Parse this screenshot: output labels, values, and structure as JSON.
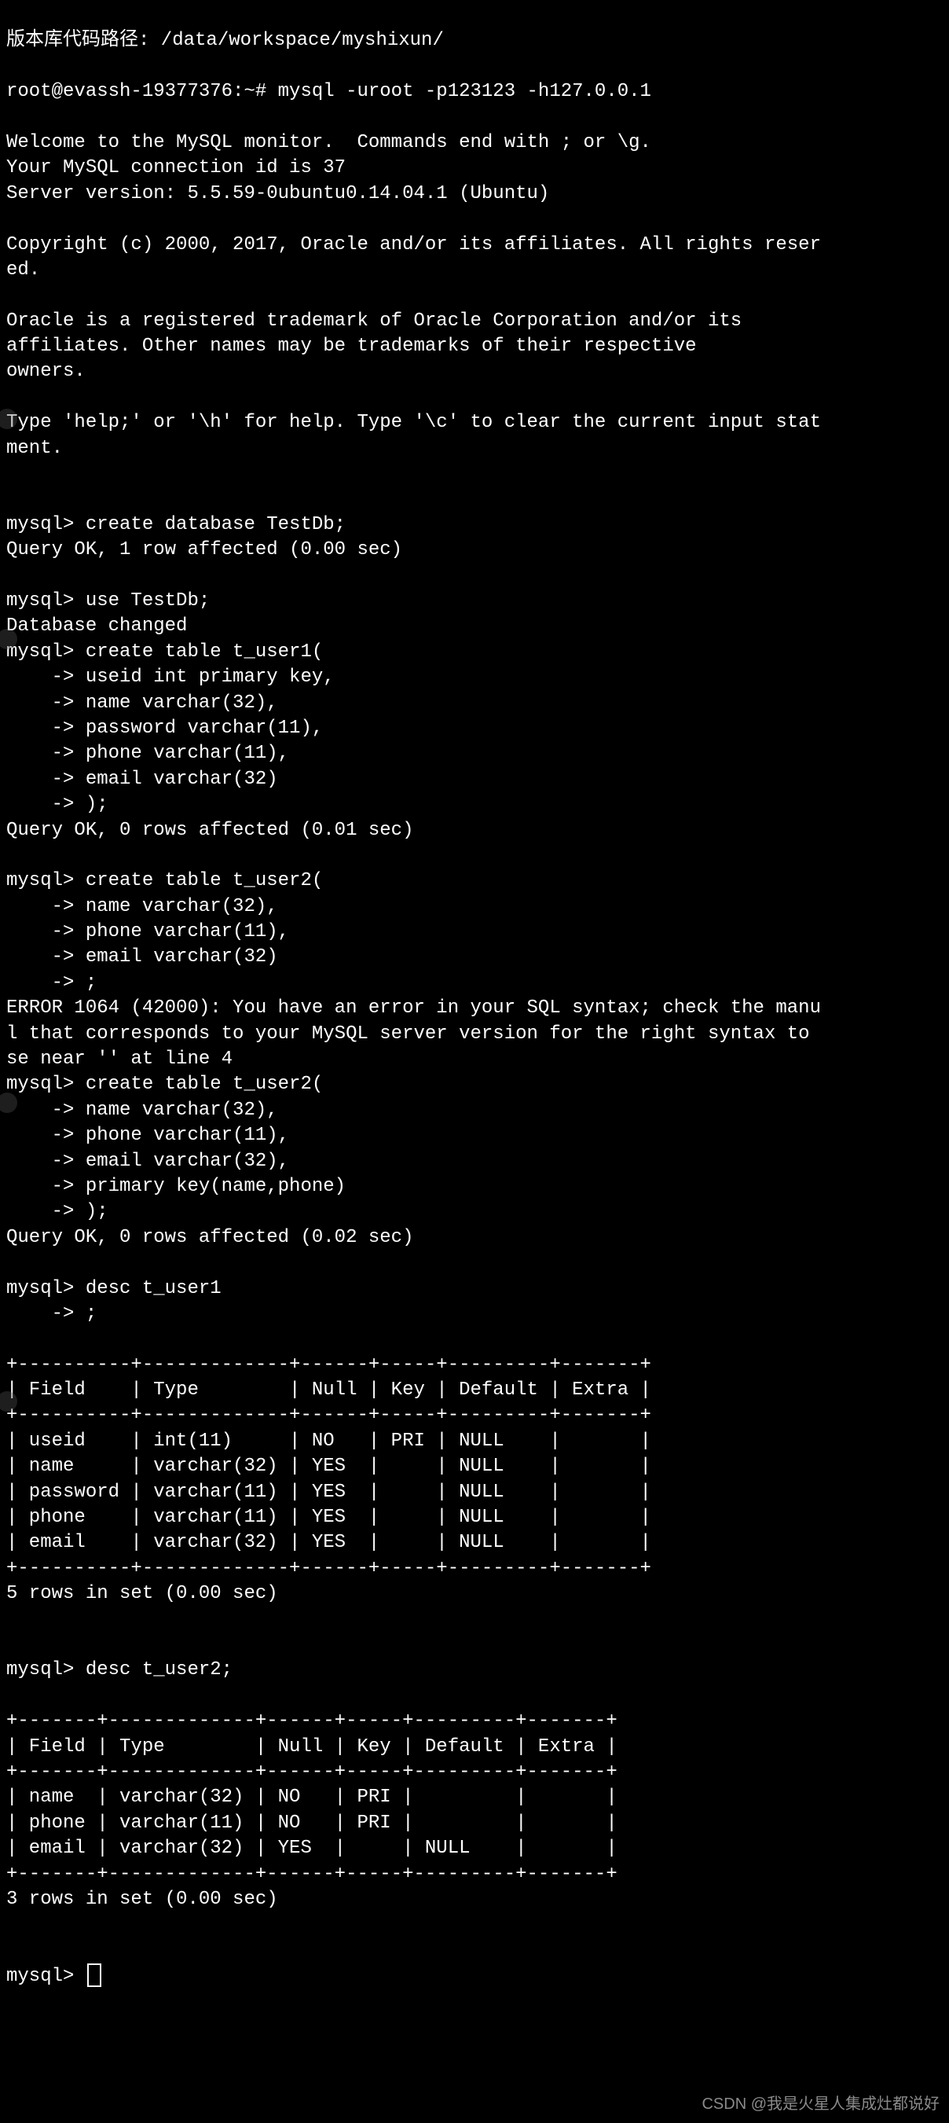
{
  "top_line": "版本库代码路径: /data/workspace/myshixun/",
  "prompt_line": "root@evassh-19377376:~# mysql -uroot -p123123 -h127.0.0.1",
  "banner": [
    "Welcome to the MySQL monitor.  Commands end with ; or \\g.",
    "Your MySQL connection id is 37",
    "Server version: 5.5.59-0ubuntu0.14.04.1 (Ubuntu)",
    "",
    "Copyright (c) 2000, 2017, Oracle and/or its affiliates. All rights reser",
    "ed.",
    "",
    "Oracle is a registered trademark of Oracle Corporation and/or its",
    "affiliates. Other names may be trademarks of their respective",
    "owners.",
    "",
    "Type 'help;' or '\\h' for help. Type '\\c' to clear the current input stat",
    "ment.",
    ""
  ],
  "session": [
    "mysql> create database TestDb;",
    "Query OK, 1 row affected (0.00 sec)",
    "",
    "mysql> use TestDb;",
    "Database changed",
    "mysql> create table t_user1(",
    "    -> useid int primary key,",
    "    -> name varchar(32),",
    "    -> password varchar(11),",
    "    -> phone varchar(11),",
    "    -> email varchar(32)",
    "    -> );",
    "Query OK, 0 rows affected (0.01 sec)",
    "",
    "mysql> create table t_user2(",
    "    -> name varchar(32),",
    "    -> phone varchar(11),",
    "    -> email varchar(32)",
    "    -> ;",
    "ERROR 1064 (42000): You have an error in your SQL syntax; check the manu",
    "l that corresponds to your MySQL server version for the right syntax to ",
    "se near '' at line 4",
    "mysql> create table t_user2(",
    "    -> name varchar(32),",
    "    -> phone varchar(11),",
    "    -> email varchar(32),",
    "    -> primary key(name,phone)",
    "    -> );",
    "Query OK, 0 rows affected (0.02 sec)",
    "",
    "mysql> desc t_user1",
    "    -> ;"
  ],
  "table1": {
    "border": "+----------+-------------+------+-----+---------+-------+",
    "header": "| Field    | Type        | Null | Key | Default | Extra |",
    "rows": [
      "| useid    | int(11)     | NO   | PRI | NULL    |       |",
      "| name     | varchar(32) | YES  |     | NULL    |       |",
      "| password | varchar(11) | YES  |     | NULL    |       |",
      "| phone    | varchar(11) | YES  |     | NULL    |       |",
      "| email    | varchar(32) | YES  |     | NULL    |       |"
    ],
    "footer": "5 rows in set (0.00 sec)"
  },
  "mid_cmd": [
    "",
    "mysql> desc t_user2;"
  ],
  "table2": {
    "border": "+-------+-------------+------+-----+---------+-------+",
    "header": "| Field | Type        | Null | Key | Default | Extra |",
    "rows": [
      "| name  | varchar(32) | NO   | PRI |         |       |",
      "| phone | varchar(11) | NO   | PRI |         |       |",
      "| email | varchar(32) | YES  |     | NULL    |       |"
    ],
    "footer": "3 rows in set (0.00 sec)"
  },
  "final_prompt": "mysql> ",
  "watermark": "CSDN @我是火星人集成灶都说好"
}
